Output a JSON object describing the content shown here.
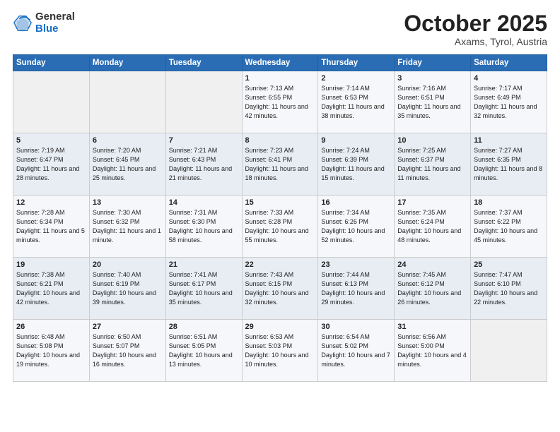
{
  "header": {
    "logo_general": "General",
    "logo_blue": "Blue",
    "title": "October 2025",
    "location": "Axams, Tyrol, Austria"
  },
  "calendar": {
    "days_of_week": [
      "Sunday",
      "Monday",
      "Tuesday",
      "Wednesday",
      "Thursday",
      "Friday",
      "Saturday"
    ],
    "weeks": [
      [
        {
          "day": "",
          "info": ""
        },
        {
          "day": "",
          "info": ""
        },
        {
          "day": "",
          "info": ""
        },
        {
          "day": "1",
          "info": "Sunrise: 7:13 AM\nSunset: 6:55 PM\nDaylight: 11 hours\nand 42 minutes."
        },
        {
          "day": "2",
          "info": "Sunrise: 7:14 AM\nSunset: 6:53 PM\nDaylight: 11 hours\nand 38 minutes."
        },
        {
          "day": "3",
          "info": "Sunrise: 7:16 AM\nSunset: 6:51 PM\nDaylight: 11 hours\nand 35 minutes."
        },
        {
          "day": "4",
          "info": "Sunrise: 7:17 AM\nSunset: 6:49 PM\nDaylight: 11 hours\nand 32 minutes."
        }
      ],
      [
        {
          "day": "5",
          "info": "Sunrise: 7:19 AM\nSunset: 6:47 PM\nDaylight: 11 hours\nand 28 minutes."
        },
        {
          "day": "6",
          "info": "Sunrise: 7:20 AM\nSunset: 6:45 PM\nDaylight: 11 hours\nand 25 minutes."
        },
        {
          "day": "7",
          "info": "Sunrise: 7:21 AM\nSunset: 6:43 PM\nDaylight: 11 hours\nand 21 minutes."
        },
        {
          "day": "8",
          "info": "Sunrise: 7:23 AM\nSunset: 6:41 PM\nDaylight: 11 hours\nand 18 minutes."
        },
        {
          "day": "9",
          "info": "Sunrise: 7:24 AM\nSunset: 6:39 PM\nDaylight: 11 hours\nand 15 minutes."
        },
        {
          "day": "10",
          "info": "Sunrise: 7:25 AM\nSunset: 6:37 PM\nDaylight: 11 hours\nand 11 minutes."
        },
        {
          "day": "11",
          "info": "Sunrise: 7:27 AM\nSunset: 6:35 PM\nDaylight: 11 hours\nand 8 minutes."
        }
      ],
      [
        {
          "day": "12",
          "info": "Sunrise: 7:28 AM\nSunset: 6:34 PM\nDaylight: 11 hours\nand 5 minutes."
        },
        {
          "day": "13",
          "info": "Sunrise: 7:30 AM\nSunset: 6:32 PM\nDaylight: 11 hours\nand 1 minute."
        },
        {
          "day": "14",
          "info": "Sunrise: 7:31 AM\nSunset: 6:30 PM\nDaylight: 10 hours\nand 58 minutes."
        },
        {
          "day": "15",
          "info": "Sunrise: 7:33 AM\nSunset: 6:28 PM\nDaylight: 10 hours\nand 55 minutes."
        },
        {
          "day": "16",
          "info": "Sunrise: 7:34 AM\nSunset: 6:26 PM\nDaylight: 10 hours\nand 52 minutes."
        },
        {
          "day": "17",
          "info": "Sunrise: 7:35 AM\nSunset: 6:24 PM\nDaylight: 10 hours\nand 48 minutes."
        },
        {
          "day": "18",
          "info": "Sunrise: 7:37 AM\nSunset: 6:22 PM\nDaylight: 10 hours\nand 45 minutes."
        }
      ],
      [
        {
          "day": "19",
          "info": "Sunrise: 7:38 AM\nSunset: 6:21 PM\nDaylight: 10 hours\nand 42 minutes."
        },
        {
          "day": "20",
          "info": "Sunrise: 7:40 AM\nSunset: 6:19 PM\nDaylight: 10 hours\nand 39 minutes."
        },
        {
          "day": "21",
          "info": "Sunrise: 7:41 AM\nSunset: 6:17 PM\nDaylight: 10 hours\nand 35 minutes."
        },
        {
          "day": "22",
          "info": "Sunrise: 7:43 AM\nSunset: 6:15 PM\nDaylight: 10 hours\nand 32 minutes."
        },
        {
          "day": "23",
          "info": "Sunrise: 7:44 AM\nSunset: 6:13 PM\nDaylight: 10 hours\nand 29 minutes."
        },
        {
          "day": "24",
          "info": "Sunrise: 7:45 AM\nSunset: 6:12 PM\nDaylight: 10 hours\nand 26 minutes."
        },
        {
          "day": "25",
          "info": "Sunrise: 7:47 AM\nSunset: 6:10 PM\nDaylight: 10 hours\nand 22 minutes."
        }
      ],
      [
        {
          "day": "26",
          "info": "Sunrise: 6:48 AM\nSunset: 5:08 PM\nDaylight: 10 hours\nand 19 minutes."
        },
        {
          "day": "27",
          "info": "Sunrise: 6:50 AM\nSunset: 5:07 PM\nDaylight: 10 hours\nand 16 minutes."
        },
        {
          "day": "28",
          "info": "Sunrise: 6:51 AM\nSunset: 5:05 PM\nDaylight: 10 hours\nand 13 minutes."
        },
        {
          "day": "29",
          "info": "Sunrise: 6:53 AM\nSunset: 5:03 PM\nDaylight: 10 hours\nand 10 minutes."
        },
        {
          "day": "30",
          "info": "Sunrise: 6:54 AM\nSunset: 5:02 PM\nDaylight: 10 hours\nand 7 minutes."
        },
        {
          "day": "31",
          "info": "Sunrise: 6:56 AM\nSunset: 5:00 PM\nDaylight: 10 hours\nand 4 minutes."
        },
        {
          "day": "",
          "info": ""
        }
      ]
    ]
  }
}
